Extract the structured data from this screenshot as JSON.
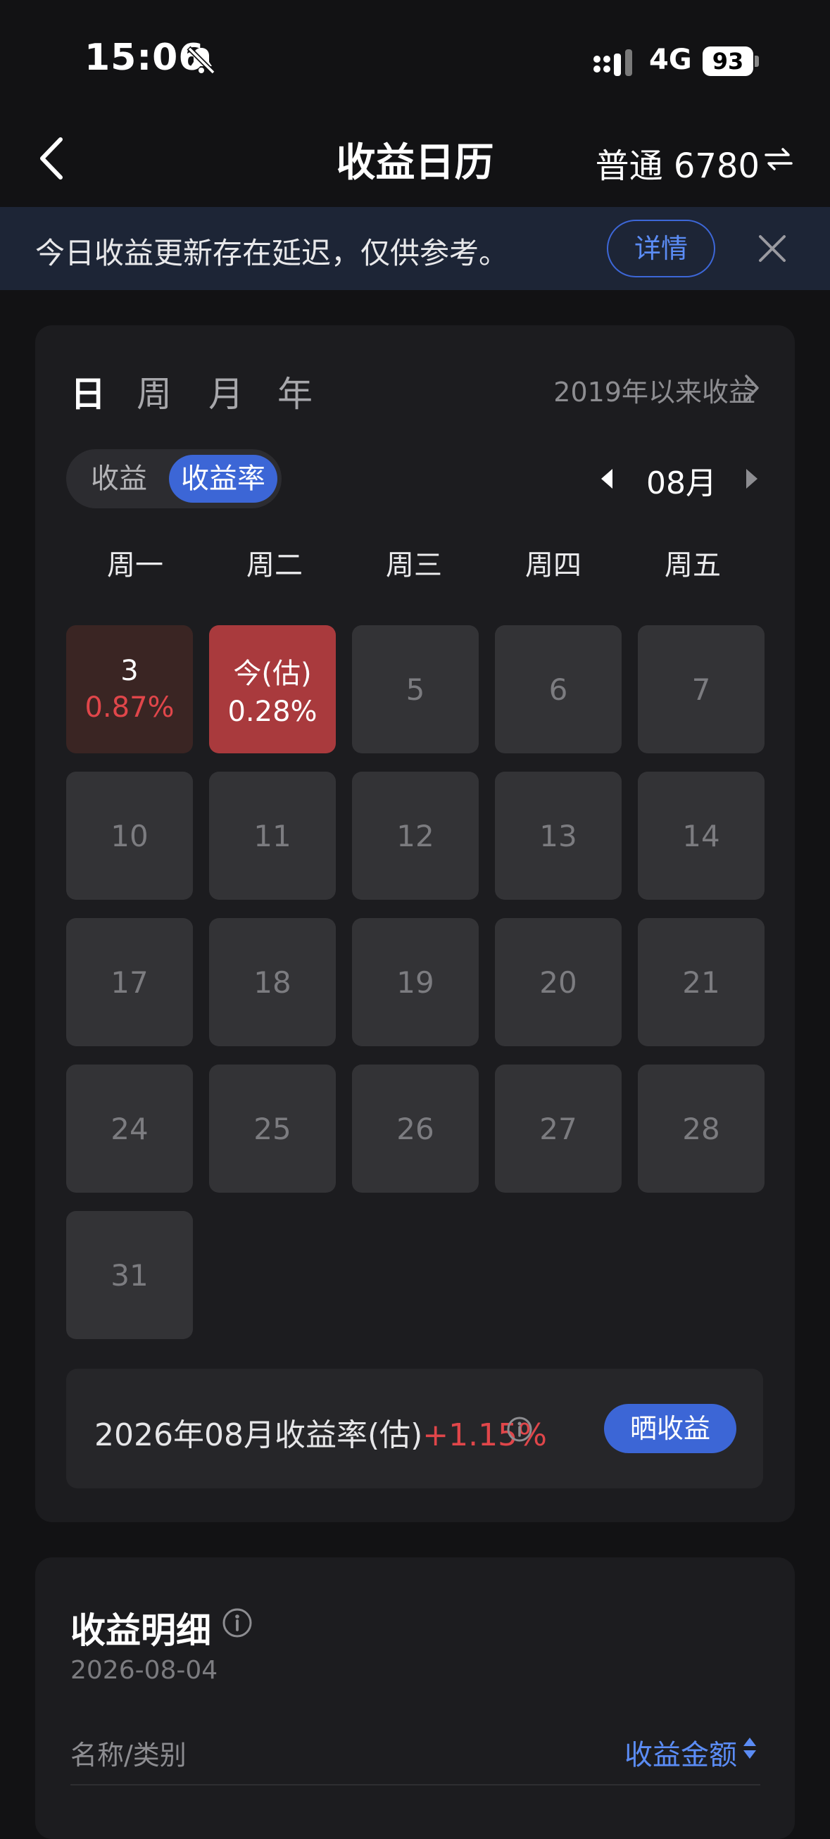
{
  "status_bar": {
    "time": "15:06",
    "network": "4G",
    "battery": "93"
  },
  "nav": {
    "title": "收益日历",
    "account": "普通 6780"
  },
  "notice": {
    "text": "今日收益更新存在延迟，仅供参考。",
    "detail_label": "详情"
  },
  "calendar": {
    "period_tabs": [
      "日",
      "周",
      "月",
      "年"
    ],
    "active_period": "日",
    "since_label": "2019年以来收益",
    "toggle": {
      "options": [
        "收益",
        "收益率"
      ],
      "active": "收益率"
    },
    "month": "08月",
    "weekdays": [
      "周一",
      "周二",
      "周三",
      "周四",
      "周五"
    ],
    "days": [
      {
        "label": "3",
        "value": "0.87%"
      },
      {
        "label": "今(估)",
        "value": "0.28%"
      },
      {
        "label": "5"
      },
      {
        "label": "6"
      },
      {
        "label": "7"
      },
      {
        "label": "10"
      },
      {
        "label": "11"
      },
      {
        "label": "12"
      },
      {
        "label": "13"
      },
      {
        "label": "14"
      },
      {
        "label": "17"
      },
      {
        "label": "18"
      },
      {
        "label": "19"
      },
      {
        "label": "20"
      },
      {
        "label": "21"
      },
      {
        "label": "24"
      },
      {
        "label": "25"
      },
      {
        "label": "26"
      },
      {
        "label": "27"
      },
      {
        "label": "28"
      },
      {
        "label": "31"
      }
    ],
    "summary": {
      "label": "2026年08月收益率(估)",
      "value": "+1.15%",
      "share_label": "晒收益"
    }
  },
  "detail": {
    "title": "收益明细",
    "date": "2026-08-04",
    "col_name": "名称/类别",
    "col_amount": "收益金额"
  },
  "colors": {
    "accent": "#3c66d6",
    "profit": "#e0464a",
    "today_bg": "#a93a3d",
    "background": "#121214"
  }
}
